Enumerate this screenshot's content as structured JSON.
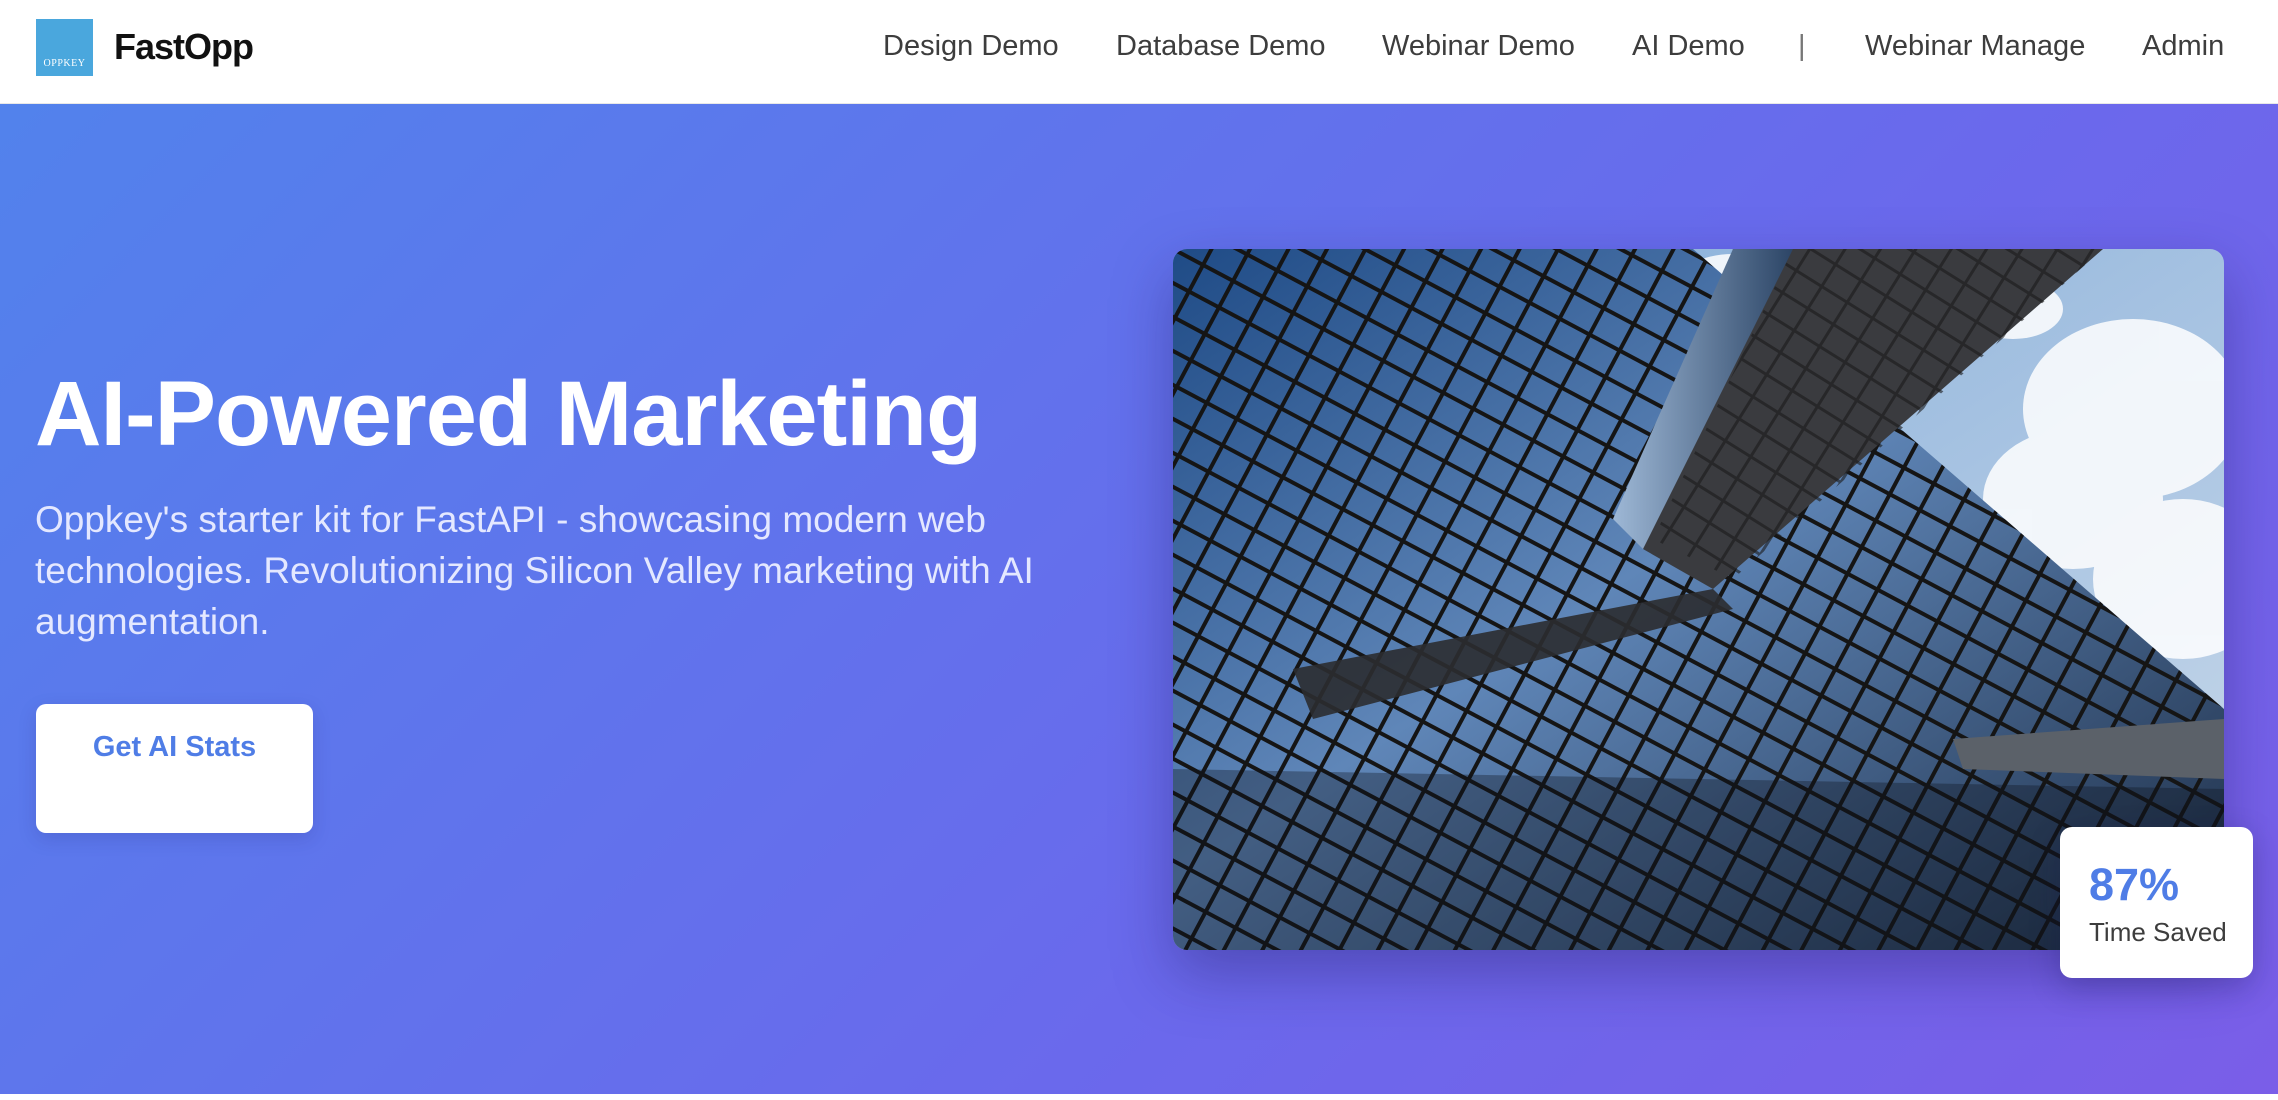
{
  "header": {
    "logo_text": "OPPKEY",
    "brand": "FastOpp",
    "nav": [
      {
        "label": "Design Demo"
      },
      {
        "label": "Database Demo"
      },
      {
        "label": "Webinar Demo"
      },
      {
        "label": "AI Demo"
      },
      {
        "label": "Webinar Manage"
      },
      {
        "label": "Admin"
      }
    ],
    "separator": "|"
  },
  "hero": {
    "title": "AI-Powered Marketing",
    "subtitle": "Oppkey's starter kit for FastAPI - showcasing modern web technologies. Revolutionizing Silicon Valley marketing with AI augmentation.",
    "cta_label": "Get AI Stats",
    "stat": {
      "value": "87%",
      "label": "Time Saved"
    }
  },
  "colors": {
    "accent": "#4f7de6",
    "gradient_start": "#5282ec",
    "gradient_end": "#7a5ee8",
    "logo_blue": "#4aa7dd"
  },
  "icons": {
    "logo": "oppkey-logo"
  }
}
